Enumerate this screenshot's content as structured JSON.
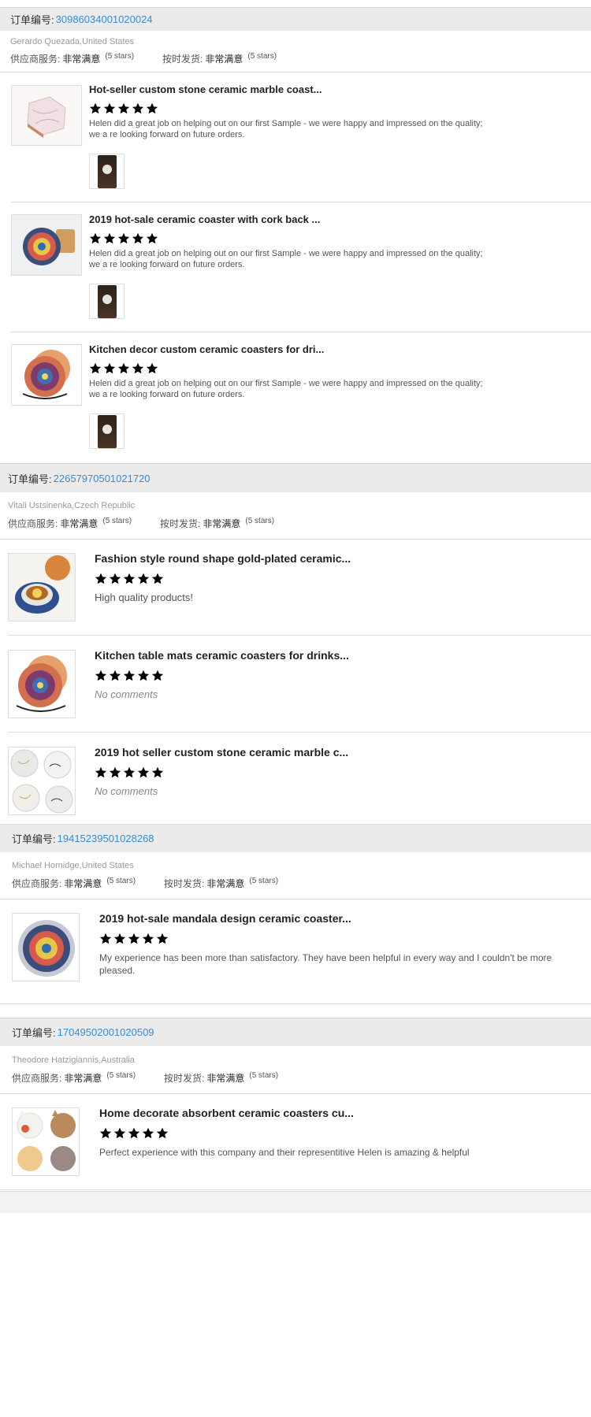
{
  "order_label": "订单编号:",
  "supplier_service_label": "供应商服务:",
  "ontime_label": "按时发货:",
  "orders": [
    {
      "order_number": "30986034001020024",
      "buyer": "Gerardo Quezada,United States",
      "supplier_value": "非常满意",
      "supplier_stars": "(5 stars)",
      "ontime_value": "非常满意",
      "ontime_stars": "(5 stars)",
      "items": [
        {
          "title": "Hot-seller custom stone ceramic marble coast...",
          "rating": 5,
          "comment": "Helen did a great job on helping out on our first Sample - we were happy and impressed on the quality; we a re looking forward on future orders.",
          "thumb_icon": "hexagon-marble-coaster-icon"
        },
        {
          "title": "2019 hot-sale ceramic coaster with cork back ...",
          "rating": 5,
          "comment": "Helen did a great job on helping out on our first Sample - we were happy and impressed on the quality; we a re looking forward on future orders.",
          "thumb_icon": "mandala-coaster-icon"
        },
        {
          "title": "Kitchen decor custom ceramic coasters for dri...",
          "rating": 5,
          "comment": "Helen did a great job on helping out on our first Sample - we were happy and impressed on the quality; we a re looking forward on future orders.",
          "thumb_icon": "coaster-set-icon"
        }
      ]
    },
    {
      "order_number": "22657970501021720",
      "buyer": "Vitali Ustsinenka,Czech Republic",
      "supplier_value": "非常满意",
      "supplier_stars": "(5 stars)",
      "ontime_value": "非常满意",
      "ontime_stars": "(5 stars)",
      "items": [
        {
          "title": "Fashion style round shape gold-plated ceramic...",
          "rating": 5,
          "comment": "High quality products!",
          "thumb_icon": "tea-cup-coaster-icon"
        },
        {
          "title": "Kitchen table mats ceramic coasters for drinks...",
          "rating": 5,
          "comment": "No comments",
          "thumb_icon": "coaster-set-icon"
        },
        {
          "title": "2019 hot seller custom stone ceramic marble c...",
          "rating": 5,
          "comment": "No comments",
          "thumb_icon": "marble-coasters-icon"
        }
      ]
    },
    {
      "order_number": "19415239501028268",
      "buyer": "Michael Hornidge,United States",
      "supplier_value": "非常满意",
      "supplier_stars": "(5 stars)",
      "ontime_value": "非常满意",
      "ontime_stars": "(5 stars)",
      "items": [
        {
          "title": "2019 hot-sale mandala design ceramic coaster...",
          "rating": 5,
          "comment": "My experience has been more than satisfactory. They have been helpful in every way and I couldn't be more pleased.",
          "thumb_icon": "mandala-coaster-icon"
        }
      ]
    },
    {
      "order_number": "17049502001020509",
      "buyer": "Theodore Hatzigiannis,Australia",
      "supplier_value": "非常满意",
      "supplier_stars": "(5 stars)",
      "ontime_value": "非常满意",
      "ontime_stars": "(5 stars)",
      "items": [
        {
          "title": "Home decorate absorbent ceramic coasters cu...",
          "rating": 5,
          "comment": "Perfect experience with this company and their representitive Helen is amazing & helpful",
          "thumb_icon": "cat-coasters-icon"
        }
      ]
    }
  ],
  "colors": {
    "star": "#f26b1d",
    "order_number": "#3a8bd0",
    "header_bg": "#ebebeb"
  }
}
